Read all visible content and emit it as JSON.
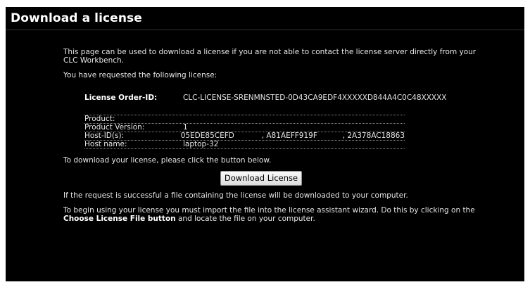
{
  "page": {
    "title": "Download a license"
  },
  "intro": {
    "line1": "This page can be used to download a license if you are not able to contact the license server directly from your CLC Workbench.",
    "requested": "You have requested the following license:"
  },
  "license": {
    "order_label": "License Order-ID:",
    "order_id": "CLC-LICENSE-SRENMNSTED-0D43CA9EDF4XXXXXD844A4C0C48XXXXX",
    "rows": {
      "product_label": "Product:",
      "product_value": "",
      "version_label": "Product Version:",
      "version_value": "1",
      "host_ids_label": "Host-ID(s):",
      "host_id_1": "05EDE85CEFD",
      "host_id_2": ", A81AEFF919F",
      "host_id_3": ", 2A378AC18863",
      "host_name_label": "Host name:",
      "host_name_value": "laptop-32"
    }
  },
  "download": {
    "prompt": "To download your license, please click the button below.",
    "button_label": "Download License"
  },
  "footer": {
    "success": "If the request is successful a file containing the license will be downloaded to your computer.",
    "instructions_part1": "To begin using your license you must import the file into the license assistant wizard. Do this by clicking on the ",
    "instructions_bold": "Choose License File button",
    "instructions_part2": " and locate the file on your computer."
  },
  "colors": {
    "background": "#000000",
    "text": "#e6e6e6",
    "heading": "#ffffff"
  }
}
